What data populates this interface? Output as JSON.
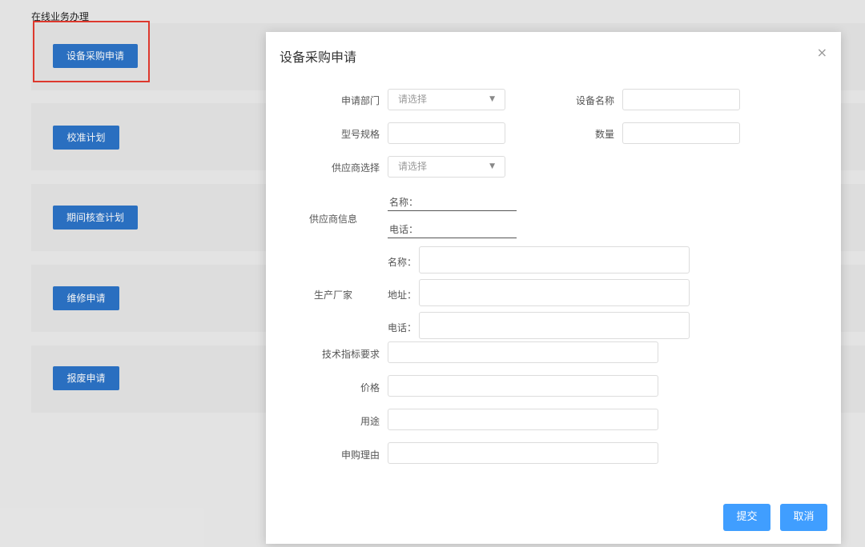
{
  "page": {
    "title": "在线业务办理"
  },
  "cards": [
    {
      "button": "设备采购申请"
    },
    {
      "button": "校准计划"
    },
    {
      "button": "期间核查计划"
    },
    {
      "button": "维修申请"
    },
    {
      "button": "报废申请"
    }
  ],
  "modal": {
    "title": "设备采购申请",
    "close": "×",
    "fields": {
      "dept_label": "申请部门",
      "dept_placeholder": "请选择",
      "device_name_label": "设备名称",
      "model_label": "型号规格",
      "qty_label": "数量",
      "supplier_select_label": "供应商选择",
      "supplier_select_placeholder": "请选择",
      "supplier_info_label": "供应商信息",
      "supplier_name_label": "名称：",
      "supplier_phone_label": "电话：",
      "manufacturer_label": "生产厂家",
      "mfr_name_label": "名称：",
      "mfr_address_label": "地址：",
      "mfr_phone_label": "电话：",
      "tech_label": "技术指标要求",
      "price_label": "价格",
      "usage_label": "用途",
      "reason_label": "申购理由"
    },
    "buttons": {
      "submit": "提交",
      "cancel": "取消"
    }
  },
  "colors": {
    "primary": "#2c74c8",
    "accent": "#409eff",
    "highlight": "#e63b2f"
  }
}
